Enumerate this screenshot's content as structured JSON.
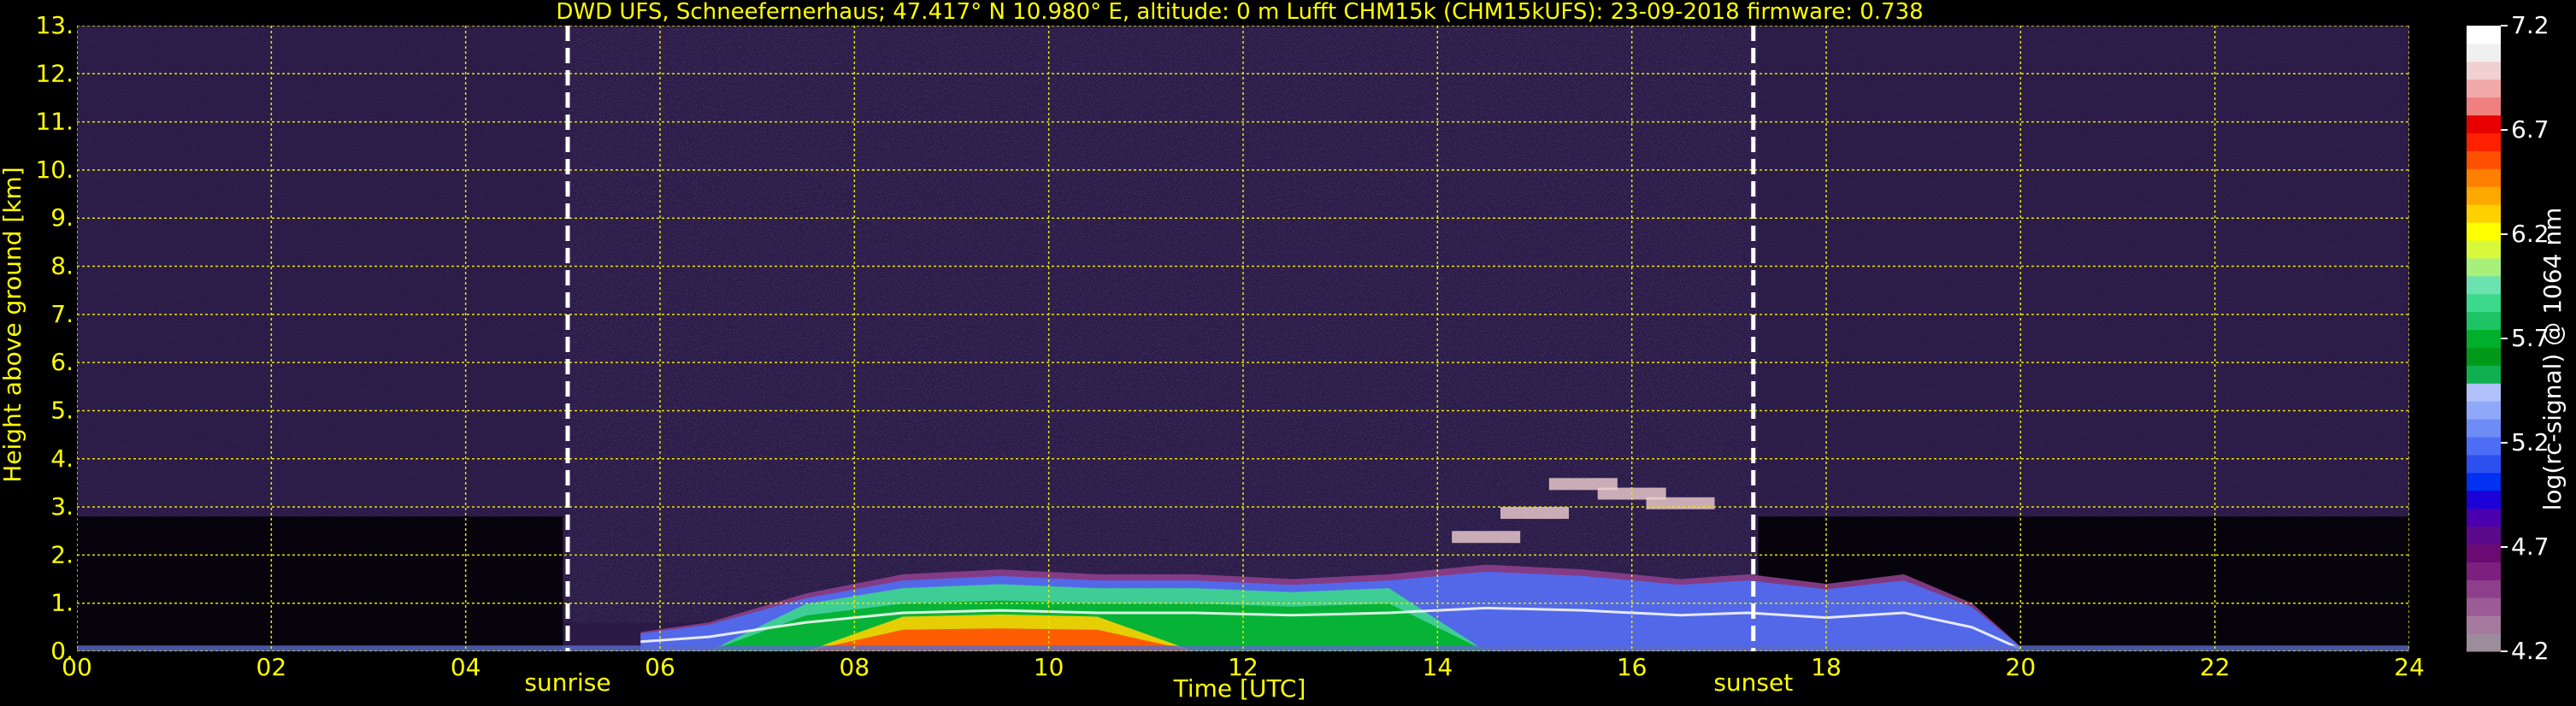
{
  "chart_data": {
    "type": "heatmap",
    "title": "DWD UFS, Schneefernerhaus; 47.417° N 10.980° E, altitude: 0 m    Lufft CHM15k (CHM15kUFS): 23-09-2018    firmware: 0.738",
    "xlabel": "Time [UTC]",
    "ylabel": "Height above ground [km]",
    "x_ticks": [
      "00",
      "02",
      "04",
      "06",
      "08",
      "10",
      "12",
      "14",
      "16",
      "18",
      "20",
      "22",
      "24"
    ],
    "y_ticks": [
      "0.",
      "1.",
      "2.",
      "3.",
      "4.",
      "5.",
      "6.",
      "7.",
      "8.",
      "9.",
      "10.",
      "11.",
      "12.",
      "13."
    ],
    "xlim": [
      0,
      24
    ],
    "ylim": [
      0,
      13
    ],
    "grid": true,
    "markers": [
      {
        "label": "sunrise",
        "time": 5.05
      },
      {
        "label": "sunset",
        "time": 17.25
      }
    ],
    "colorbar": {
      "label": "log(rc-signal) @ 1064 nm",
      "range": [
        4.2,
        7.2
      ],
      "ticks": [
        "4.2",
        "4.7",
        "5.2",
        "5.7",
        "6.2",
        "6.7",
        "7.2"
      ],
      "colors": [
        "#9c8c9c",
        "#a6799e",
        "#9a5b96",
        "#8e3f8c",
        "#7c1f7e",
        "#6a0a72",
        "#5a0a8a",
        "#4b00b0",
        "#1c00d8",
        "#0030f0",
        "#2c50f0",
        "#4d6ef4",
        "#6e8cf6",
        "#90a8f8",
        "#b0c0fa",
        "#10b050",
        "#009a18",
        "#00b02c",
        "#1cc464",
        "#3cd88c",
        "#6ce2b0",
        "#a8f07c",
        "#d8f83c",
        "#ffff00",
        "#ffd000",
        "#ffa800",
        "#ff8000",
        "#ff5000",
        "#ff2000",
        "#e80000",
        "#f08080",
        "#f0a8a8",
        "#f0d0d0",
        "#f0f0f0",
        "#ffffff"
      ]
    },
    "signal_layers": [
      {
        "name": "boundary-layer",
        "t": [
          5.8,
          6.5,
          7.5,
          8.5,
          9.5,
          10.5,
          11.5,
          12.5,
          13.5,
          14.5,
          15.5,
          16.5,
          17.2,
          18.0,
          18.8,
          19.5,
          20.0
        ],
        "top_km": [
          0.4,
          0.6,
          1.2,
          1.6,
          1.7,
          1.6,
          1.6,
          1.5,
          1.6,
          1.8,
          1.7,
          1.5,
          1.6,
          1.4,
          1.6,
          1.0,
          0.1
        ]
      },
      {
        "name": "cloud-band",
        "t": [
          14.5,
          15.0,
          15.5,
          16.0,
          16.5
        ],
        "top_km": [
          2.5,
          3.0,
          3.6,
          3.4,
          3.2
        ]
      }
    ],
    "noise_region": {
      "t_start": 5.0,
      "t_end": 17.3
    }
  }
}
